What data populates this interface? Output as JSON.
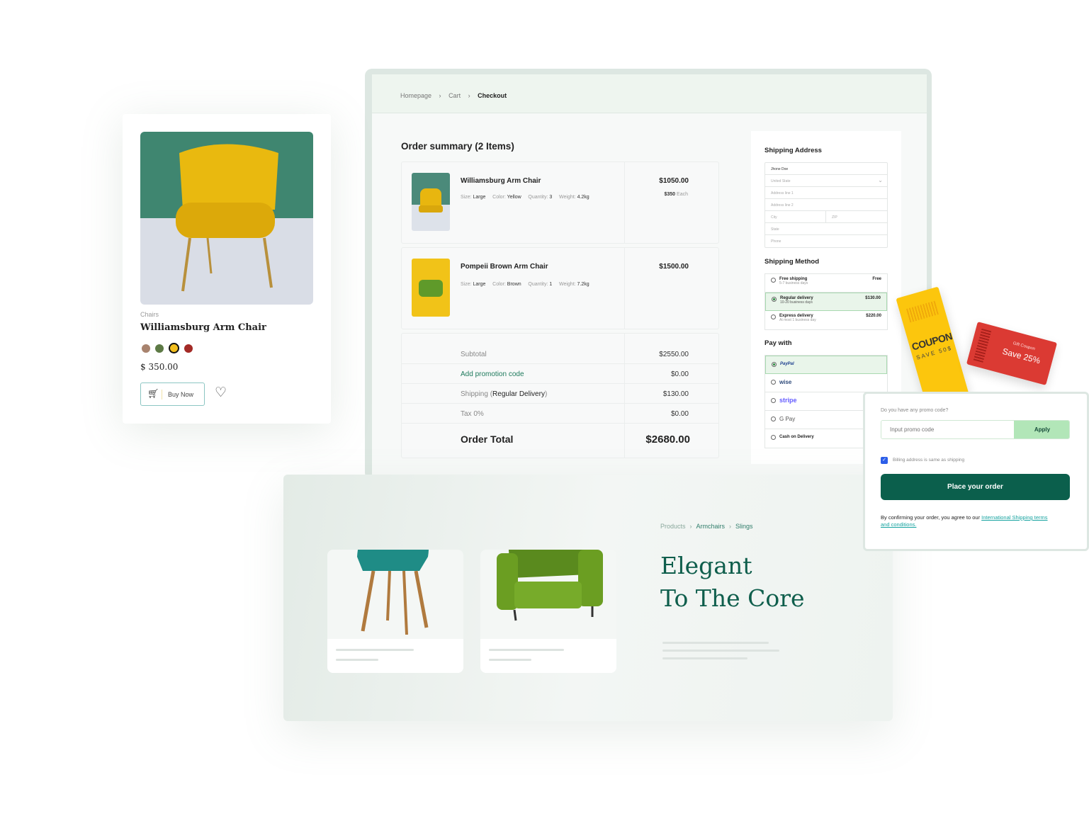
{
  "checkout": {
    "breadcrumb": [
      "Homepage",
      "Cart",
      "Checkout"
    ],
    "order_summary_title": "Order summary (2 Items)",
    "items": [
      {
        "name": "Williamsburg Arm Chair",
        "size": "Large",
        "color": "Yellow",
        "quantity": "3",
        "weight": "4.2kg",
        "total": "$1050.00",
        "each_price": "$350",
        "each_label": "Each"
      },
      {
        "name": "Pompeii Brown Arm Chair",
        "size": "Large",
        "color": "Brown",
        "quantity": "1",
        "weight": "7.2kg",
        "total": "$1500.00"
      }
    ],
    "labels": {
      "size": "Size:",
      "color": "Color:",
      "quantity": "Quantity:",
      "weight": "Weight:"
    },
    "totals": {
      "subtotal_label": "Subtotal",
      "subtotal": "$2550.00",
      "promo_label": "Add promotion code",
      "promo": "$0.00",
      "shipping_label": "Shipping (",
      "shipping_method": "Regular Delivery",
      "shipping_close": ")",
      "shipping": "$130.00",
      "tax_label": "Tax 0%",
      "tax": "$0.00",
      "order_total_label": "Order Total",
      "order_total": "$2680.00"
    },
    "shipping_address": {
      "title": "Shipping Address",
      "name": "Jhone Doe",
      "country": "United State",
      "address1": "Address line 1",
      "address2": "Address line 2",
      "city": "City",
      "zip": "ZIP",
      "state": "State",
      "phone": "Phone"
    },
    "shipping_method": {
      "title": "Shipping Method",
      "options": [
        {
          "title": "Free shipping",
          "sub": "5-7 business days",
          "price": "Free"
        },
        {
          "title": "Regular delivery",
          "sub": "10-20 business days",
          "price": "$130.00"
        },
        {
          "title": "Express delivery",
          "sub": "At most 1 business day",
          "price": "$220.00"
        }
      ]
    },
    "pay_with": {
      "title": "Pay with",
      "options": [
        "PayPal",
        "wise",
        "stripe",
        "G Pay",
        "Cash on Delivery"
      ],
      "selected": "PayPal"
    }
  },
  "promo_panel": {
    "question": "Do you have any promo code?",
    "placeholder": "Input promo code",
    "apply": "Apply",
    "billing_label": "Billing address is same as shipping",
    "billing_checked": true,
    "place_order": "Place your order",
    "terms_prefix": "By confirming your order, you agree to our ",
    "terms_link": "International Shipping terms and conditions."
  },
  "coupons": {
    "yellow_title": "COUPON",
    "yellow_sub": "SAVE 50$",
    "red_small": "Gift Coupon",
    "red_big": "Save 25%"
  },
  "product_card": {
    "category": "Chairs",
    "name": "Williamsburg Arm Chair",
    "colors": [
      "#a8836e",
      "#5d7a45",
      "#f2be1e",
      "#a32a26"
    ],
    "selected_color": "#f2be1e",
    "price": "$ 350.00",
    "buy_now": "Buy Now"
  },
  "banner": {
    "breadcrumb": [
      "Products",
      "Armchairs",
      "Slings"
    ],
    "headline_1": "Elegant",
    "headline_2": "To The Core"
  },
  "colors": {
    "primary": "#0b5f4c",
    "accent_green": "#b2e6b8",
    "teal_link": "#16a3a0"
  }
}
